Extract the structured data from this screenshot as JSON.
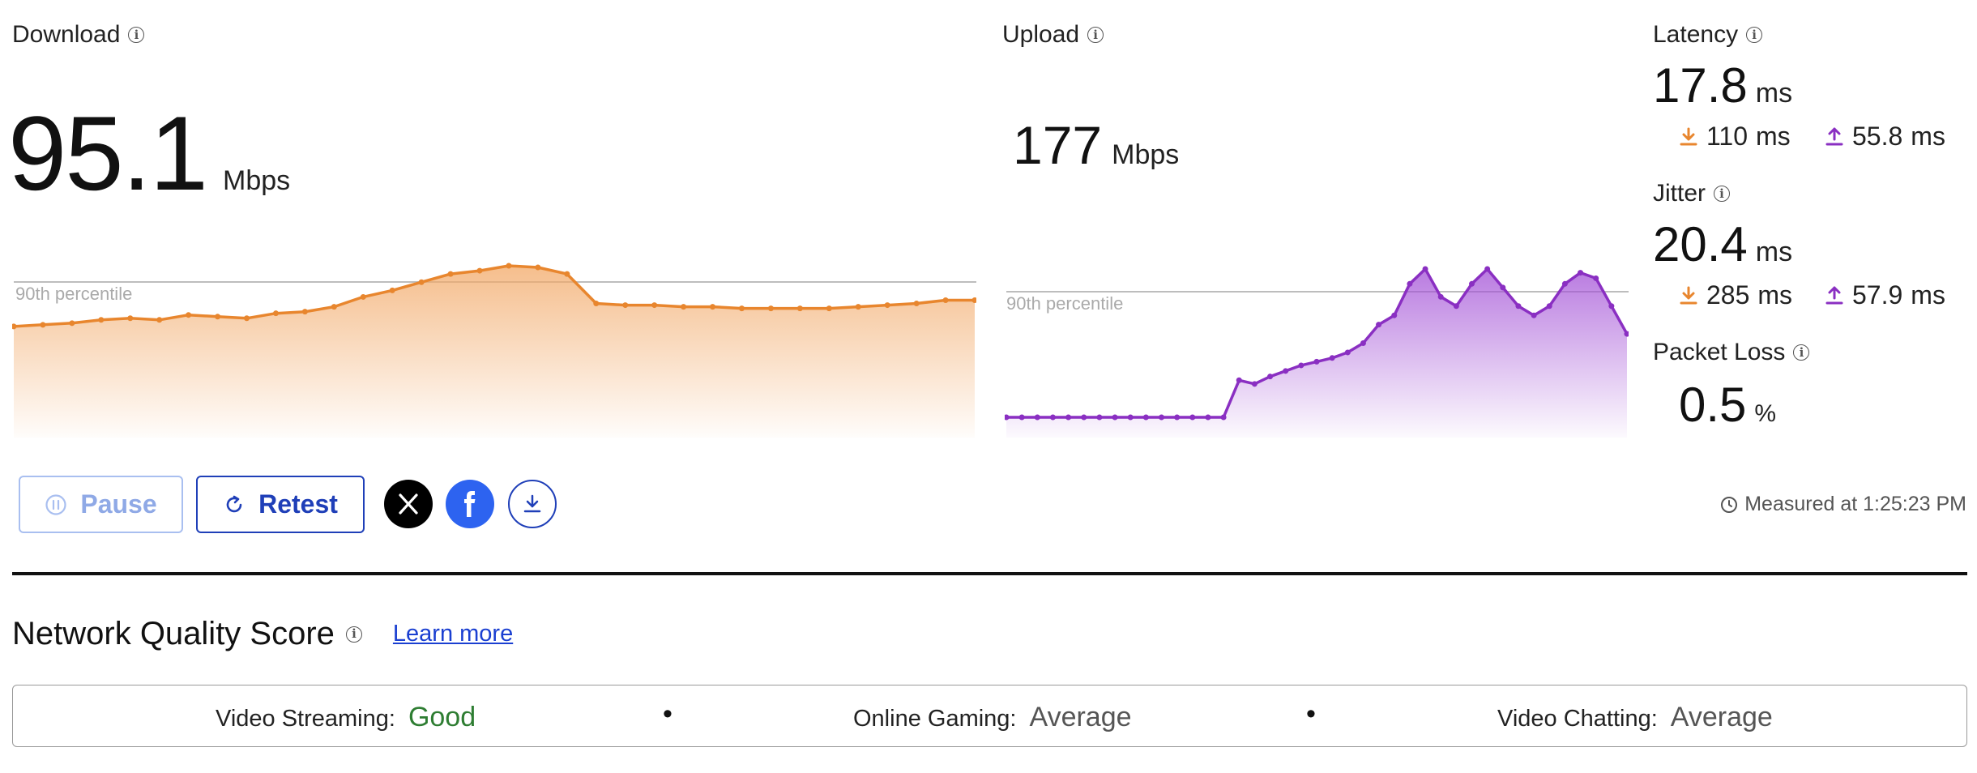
{
  "download": {
    "label": "Download",
    "value": "95.1",
    "unit": "Mbps",
    "percentile_label": "90th percentile",
    "color": "#e8862e",
    "samples": [
      48,
      49,
      50,
      52,
      53,
      52,
      55,
      54,
      53,
      56,
      57,
      60,
      66,
      70,
      75,
      80,
      82,
      85,
      84,
      80,
      62,
      61,
      61,
      60,
      60,
      59,
      59,
      59,
      59,
      60,
      61,
      62,
      64,
      64
    ]
  },
  "upload": {
    "label": "Upload",
    "value": "177",
    "unit": "Mbps",
    "percentile_label": "90th percentile",
    "color": "#8a2fc2",
    "samples": [
      0,
      0,
      0,
      0,
      0,
      0,
      0,
      0,
      0,
      0,
      0,
      0,
      0,
      0,
      0,
      20,
      18,
      22,
      25,
      28,
      30,
      32,
      35,
      40,
      50,
      55,
      72,
      80,
      65,
      60,
      72,
      80,
      70,
      60,
      55,
      60,
      72,
      78,
      75,
      60,
      45
    ]
  },
  "latency": {
    "label": "Latency",
    "value": "17.8",
    "unit": "ms",
    "down_value": "110",
    "up_value": "55.8",
    "sub_unit": "ms"
  },
  "jitter": {
    "label": "Jitter",
    "value": "20.4",
    "unit": "ms",
    "down_value": "285",
    "up_value": "57.9",
    "sub_unit": "ms"
  },
  "packet_loss": {
    "label": "Packet Loss",
    "value": "0.5",
    "unit": "%"
  },
  "actions": {
    "pause_label": "Pause",
    "retest_label": "Retest"
  },
  "measured": {
    "text": "Measured at 1:25:23 PM"
  },
  "network_quality": {
    "title": "Network Quality Score",
    "learn_more": "Learn more",
    "items": [
      {
        "label": "Video Streaming:",
        "value": "Good",
        "color": "#2e7d32"
      },
      {
        "label": "Online Gaming:",
        "value": "Average",
        "color": "#555555"
      },
      {
        "label": "Video Chatting:",
        "value": "Average",
        "color": "#555555"
      }
    ],
    "separator": "•"
  },
  "icons": {
    "info": "info-icon",
    "download_arrow": "download-arrow-icon",
    "upload_arrow": "upload-arrow-icon",
    "pause": "pause-icon",
    "retest": "refresh-icon",
    "x": "x-logo-icon",
    "facebook": "facebook-icon",
    "save": "download-results-icon",
    "clock": "clock-icon"
  }
}
